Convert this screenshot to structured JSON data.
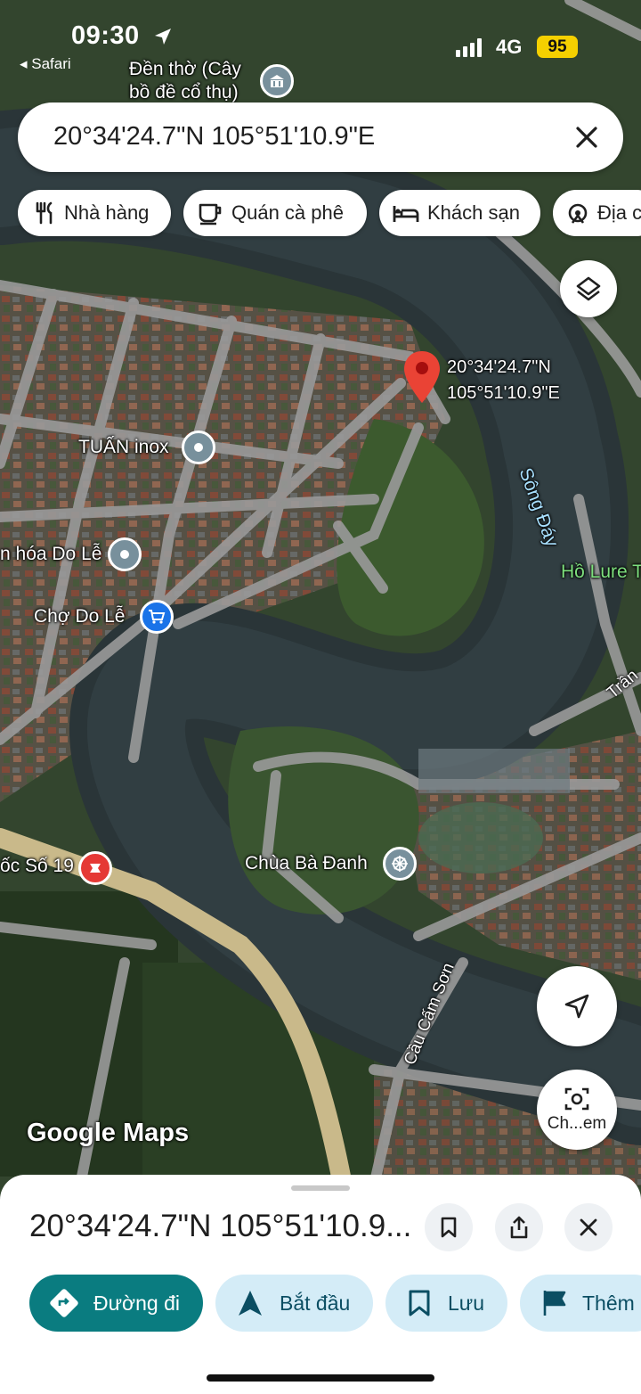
{
  "status_bar": {
    "time": "09:30",
    "back_app": "◂ Safari",
    "network": "4G",
    "battery": "95"
  },
  "search": {
    "query": "20°34'24.7\"N 105°51'10.9\"E"
  },
  "chips": [
    {
      "label": "Nhà hàng",
      "icon": "fork-knife-icon"
    },
    {
      "label": "Quán cà phê",
      "icon": "coffee-cup-icon"
    },
    {
      "label": "Khách sạn",
      "icon": "bed-icon"
    },
    {
      "label": "Địa c",
      "icon": "attractions-icon"
    }
  ],
  "map": {
    "pin_label_line1": "20°34'24.7\"N",
    "pin_label_line2": "105°51'10.9\"E",
    "places": {
      "den_tho_line1": "Đền thờ (Cây",
      "den_tho_line2": "bồ đề cổ thụ)",
      "tuan_inox": "TUẤN inox",
      "hoa_do_le": "n hóa Do Lễ",
      "cho_do_le": "Chợ Do Lễ",
      "oc_so_19": "ốc Số 19",
      "chua_ba_danh": "Chùa Bà Đanh",
      "ho_lure": "Hồ Lure T",
      "song_day": "Sông Đáy",
      "cau_cam_son": "Cầu Cấm Sơn",
      "tran": "Trần"
    },
    "watermark": "Google Maps",
    "streetview_label": "Ch...em",
    "colors": {
      "pin": "#ea4335",
      "water_label": "#a8e0ff",
      "park_label": "#7ee07e",
      "accent": "#0a7c80"
    }
  },
  "sheet": {
    "title": "20°34'24.7\"N 105°51'10.9...",
    "actions": [
      {
        "label": "Đường đi",
        "icon": "directions-icon"
      },
      {
        "label": "Bắt đầu",
        "icon": "navigation-arrow-icon"
      },
      {
        "label": "Lưu",
        "icon": "bookmark-icon"
      },
      {
        "label": "Thêm",
        "icon": "flag-icon"
      }
    ]
  }
}
